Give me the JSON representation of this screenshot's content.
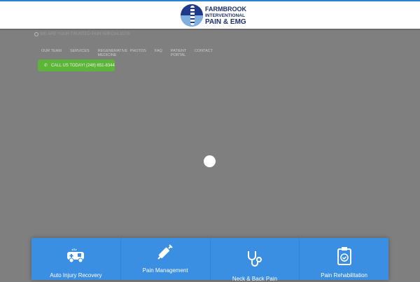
{
  "header": {
    "logo": {
      "line1": "FARMBROOK",
      "line2": "INTERVENTIONAL",
      "line3": "PAIN & EMG"
    }
  },
  "tagline": "WE ARE YOUR TRUSTED PAIN SPECIALISTS!",
  "nav": [
    {
      "label": "OUR TEAM"
    },
    {
      "label": "SERVICES"
    },
    {
      "label": "REGENERATIVE MEDICINE"
    },
    {
      "label": "PHOTOS"
    },
    {
      "label": "FAQ"
    },
    {
      "label": "PATIENT PORTAL"
    },
    {
      "label": "CONTACT"
    }
  ],
  "call_button": "CALL US TODAY! (248) 651-8344",
  "services": [
    {
      "label": "Auto Injury Recovery",
      "icon": "ambulance-icon"
    },
    {
      "label": "Pain Management",
      "icon": "syringe-icon"
    },
    {
      "label": "Neck & Back Pain",
      "icon": "stethoscope-icon"
    },
    {
      "label": "Pain Rehabilitation",
      "icon": "clipboard-check-icon"
    }
  ],
  "colors": {
    "accent": "#3b8fe3",
    "call": "#5cb53a",
    "overlay": "#7f7f7f"
  }
}
